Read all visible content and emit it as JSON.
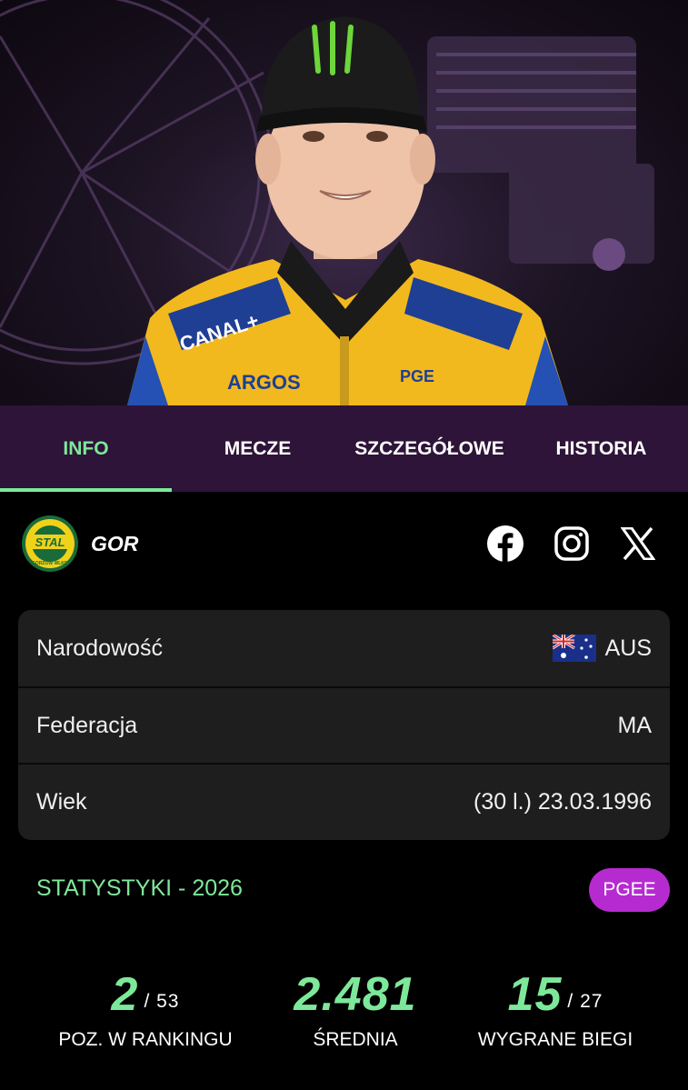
{
  "tabs": [
    {
      "label": "INFO",
      "active": true
    },
    {
      "label": "MECZE",
      "active": false
    },
    {
      "label": "SZCZEGÓŁOWE",
      "active": false
    },
    {
      "label": "HISTORIA",
      "active": false
    }
  ],
  "team": {
    "code": "GOR",
    "logo_text": "STAL",
    "logo_subtext": "GORZÓW WLKP."
  },
  "social": [
    "facebook-icon",
    "instagram-icon",
    "x-icon"
  ],
  "info": [
    {
      "label": "Narodowość",
      "value": "AUS",
      "flag": "australia-flag"
    },
    {
      "label": "Federacja",
      "value": "MA"
    },
    {
      "label": "Wiek",
      "value": "(30 l.) 23.03.1996"
    }
  ],
  "stats": {
    "title": "STATYSTYKI - 2026",
    "badge": "PGEE",
    "items": [
      {
        "value": "2",
        "of": "/ 53",
        "label": "POZ. W RANKINGU"
      },
      {
        "value": "2.481",
        "of": "",
        "label": "ŚREDNIA"
      },
      {
        "value": "15",
        "of": "/ 27",
        "label": "WYGRANE BIEGI"
      }
    ]
  },
  "colors": {
    "accent": "#7ee89a",
    "tabs_bg": "#2e1438",
    "badge": "#b62bd0",
    "card": "#1e1e1e"
  }
}
